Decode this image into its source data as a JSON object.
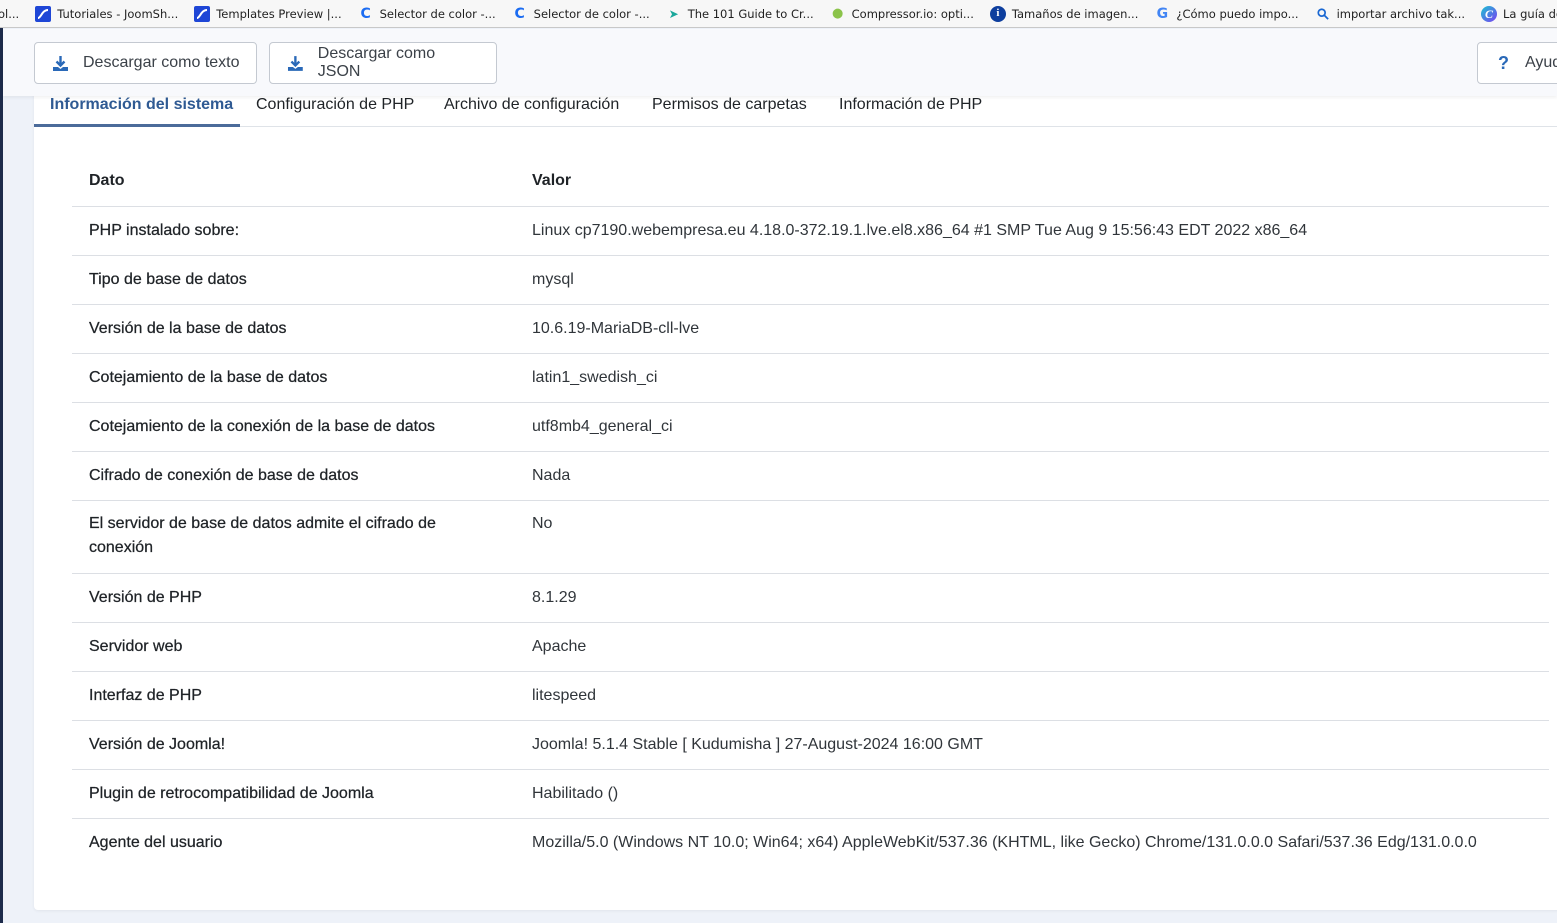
{
  "bookmarks": [
    {
      "label": "ol...",
      "icon": "truncated"
    },
    {
      "label": "Tutoriales - JoomSh...",
      "icon": "joomshaper-icon"
    },
    {
      "label": "Templates Preview |...",
      "icon": "joomshaper-icon"
    },
    {
      "label": "Selector de color -...",
      "icon": "c-icon"
    },
    {
      "label": "Selector de color -...",
      "icon": "c-icon"
    },
    {
      "label": "The 101 Guide to Cr...",
      "icon": "arrow-icon"
    },
    {
      "label": "Compressor.io: opti...",
      "icon": "chameleon-icon"
    },
    {
      "label": "Tamaños de imagen...",
      "icon": "info-icon"
    },
    {
      "label": "¿Cómo puedo impo...",
      "icon": "google-icon"
    },
    {
      "label": "importar archivo tak...",
      "icon": "search-icon"
    },
    {
      "label": "La guía definitiva pa...",
      "icon": "canva-icon"
    }
  ],
  "toolbar": {
    "download_text_label": "Descargar como texto",
    "download_json_label": "Descargar como JSON",
    "help_label": "Ayuda",
    "help_icon": "?"
  },
  "tabs": [
    {
      "label": "Información del sistema",
      "active": true
    },
    {
      "label": "Configuración de PHP",
      "active": false
    },
    {
      "label": "Archivo de configuración",
      "active": false
    },
    {
      "label": "Permisos de carpetas",
      "active": false
    },
    {
      "label": "Información de PHP",
      "active": false
    }
  ],
  "table": {
    "headers": {
      "key": "Dato",
      "value": "Valor"
    },
    "rows": [
      {
        "key": "PHP instalado sobre:",
        "value": "Linux cp7190.webempresa.eu 4.18.0-372.19.1.lve.el8.x86_64 #1 SMP Tue Aug 9 15:56:43 EDT 2022 x86_64"
      },
      {
        "key": "Tipo de base de datos",
        "value": "mysql"
      },
      {
        "key": "Versión de la base de datos",
        "value": "10.6.19-MariaDB-cll-lve"
      },
      {
        "key": "Cotejamiento de la base de datos",
        "value": "latin1_swedish_ci"
      },
      {
        "key": "Cotejamiento de la conexión de la base de datos",
        "value": "utf8mb4_general_ci"
      },
      {
        "key": "Cifrado de conexión de base de datos",
        "value": "Nada"
      },
      {
        "key": "El servidor de base de datos admite el cifrado de conexión",
        "value": "No"
      },
      {
        "key": "Versión de PHP",
        "value": "8.1.29"
      },
      {
        "key": "Servidor web",
        "value": "Apache"
      },
      {
        "key": "Interfaz de PHP",
        "value": "litespeed"
      },
      {
        "key": "Versión de Joomla!",
        "value": "Joomla! 5.1.4 Stable [ Kudumisha ] 27-August-2024 16:00 GMT"
      },
      {
        "key": "Plugin de retrocompatibilidad de Joomla",
        "value": "Habilitado ()"
      },
      {
        "key": "Agente del usuario",
        "value": "Mozilla/5.0 (Windows NT 10.0; Win64; x64) AppleWebKit/537.36 (KHTML, like Gecko) Chrome/131.0.0.0 Safari/537.36 Edg/131.0.0.0"
      }
    ]
  },
  "colors": {
    "active_tab": "#2f5a93",
    "accent_icon": "#2a69b8",
    "sidebar": "#1d2b4b"
  }
}
